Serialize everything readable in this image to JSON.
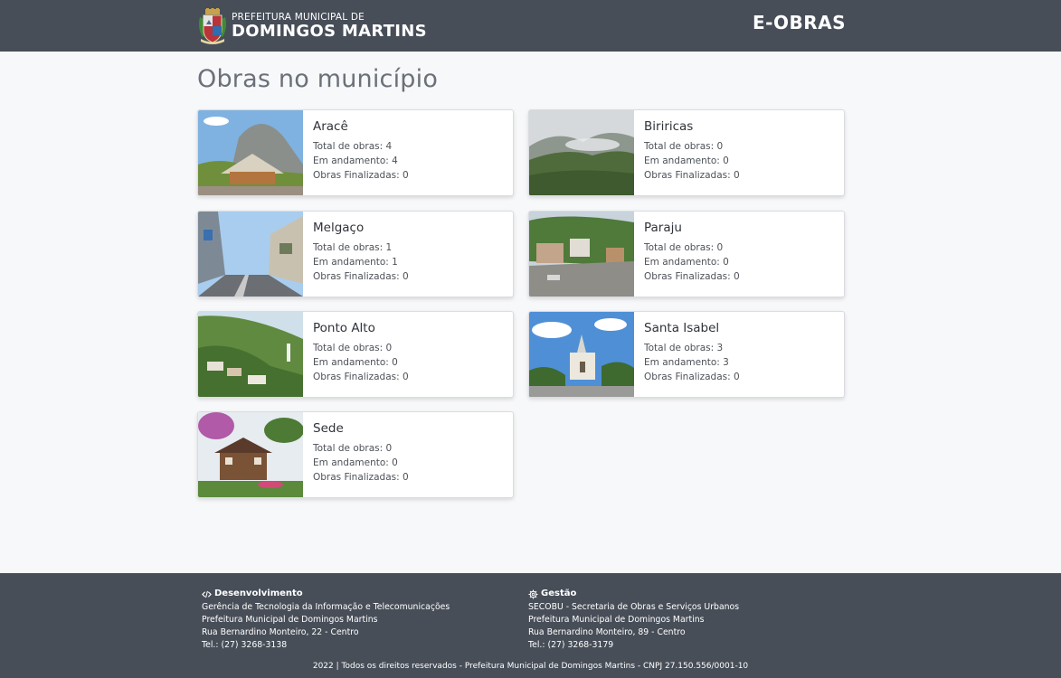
{
  "header": {
    "brand_small": "PREFEITURA MUNICIPAL DE",
    "brand_big": "DOMINGOS MARTINS",
    "app_title": "E-OBRAS"
  },
  "main": {
    "title": "Obras no município",
    "cards": [
      {
        "name": "Aracê",
        "total": "Total de obras: 4",
        "andamento": "Em andamento: 4",
        "finalizadas": "Obras Finalizadas: 0"
      },
      {
        "name": "Biriricas",
        "total": "Total de obras: 0",
        "andamento": "Em andamento: 0",
        "finalizadas": "Obras Finalizadas: 0"
      },
      {
        "name": "Melgaço",
        "total": "Total de obras: 1",
        "andamento": "Em andamento: 1",
        "finalizadas": "Obras Finalizadas: 0"
      },
      {
        "name": "Paraju",
        "total": "Total de obras: 0",
        "andamento": "Em andamento: 0",
        "finalizadas": "Obras Finalizadas: 0"
      },
      {
        "name": "Ponto Alto",
        "total": "Total de obras: 0",
        "andamento": "Em andamento: 0",
        "finalizadas": "Obras Finalizadas: 0"
      },
      {
        "name": "Santa Isabel",
        "total": "Total de obras: 3",
        "andamento": "Em andamento: 3",
        "finalizadas": "Obras Finalizadas: 0"
      },
      {
        "name": "Sede",
        "total": "Total de obras: 0",
        "andamento": "Em andamento: 0",
        "finalizadas": "Obras Finalizadas: 0"
      }
    ]
  },
  "footer": {
    "dev": {
      "title": "Desenvolvimento",
      "lines": [
        "Gerência de Tecnologia da Informação e Telecomunicações",
        "Prefeitura Municipal de Domingos Martins",
        "Rua Bernardino Monteiro, 22 - Centro",
        "Tel.: (27) 3268-3138"
      ]
    },
    "gestao": {
      "title": "Gestão",
      "lines": [
        "SECOBU - Secretaria de Obras e Serviços Urbanos",
        "Prefeitura Municipal de Domingos Martins",
        "Rua Bernardino Monteiro, 89 - Centro",
        "Tel.: (27) 3268-3179"
      ]
    },
    "copyright": "2022 | Todos os direitos reservados - Prefeitura Municipal de Domingos Martins - CNPJ 27.150.556/0001-10"
  },
  "colors": {
    "header_bg": "#474e58",
    "page_bg": "#f7f8fa",
    "title_color": "#6b7079"
  },
  "icons": {
    "crest": "municipal-crest-icon",
    "dev": "code-icon",
    "gestao": "gear-icon"
  }
}
